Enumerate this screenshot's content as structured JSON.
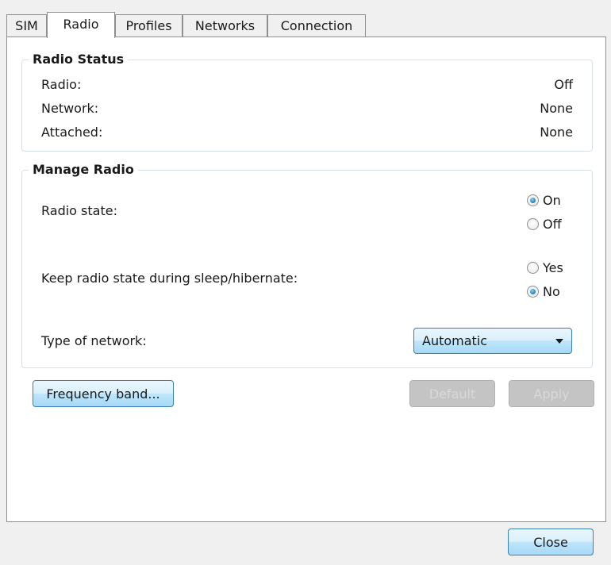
{
  "tabs": [
    {
      "label": "SIM",
      "active": false
    },
    {
      "label": "Radio",
      "active": true
    },
    {
      "label": "Profiles",
      "active": false
    },
    {
      "label": "Networks",
      "active": false
    },
    {
      "label": "Connection",
      "active": false
    }
  ],
  "radio_status": {
    "title": "Radio Status",
    "rows": [
      {
        "label": "Radio:",
        "value": "Off"
      },
      {
        "label": "Network:",
        "value": "None"
      },
      {
        "label": "Attached:",
        "value": "None"
      }
    ]
  },
  "manage_radio": {
    "title": "Manage Radio",
    "radio_state": {
      "label": "Radio state:",
      "options": [
        {
          "label": "On",
          "checked": true
        },
        {
          "label": "Off",
          "checked": false
        }
      ]
    },
    "keep_state": {
      "label": "Keep radio state during sleep/hibernate:",
      "options": [
        {
          "label": "Yes",
          "checked": false
        },
        {
          "label": "No",
          "checked": true
        }
      ]
    },
    "network_type": {
      "label": "Type of network:",
      "selected": "Automatic"
    }
  },
  "buttons": {
    "frequency_band": "Frequency band...",
    "default": "Default",
    "apply": "Apply",
    "close": "Close"
  },
  "colors": {
    "accent": "#3c7fb1",
    "radio_checked": "#1d7db8",
    "disabled_button": "#c4c4c4"
  }
}
